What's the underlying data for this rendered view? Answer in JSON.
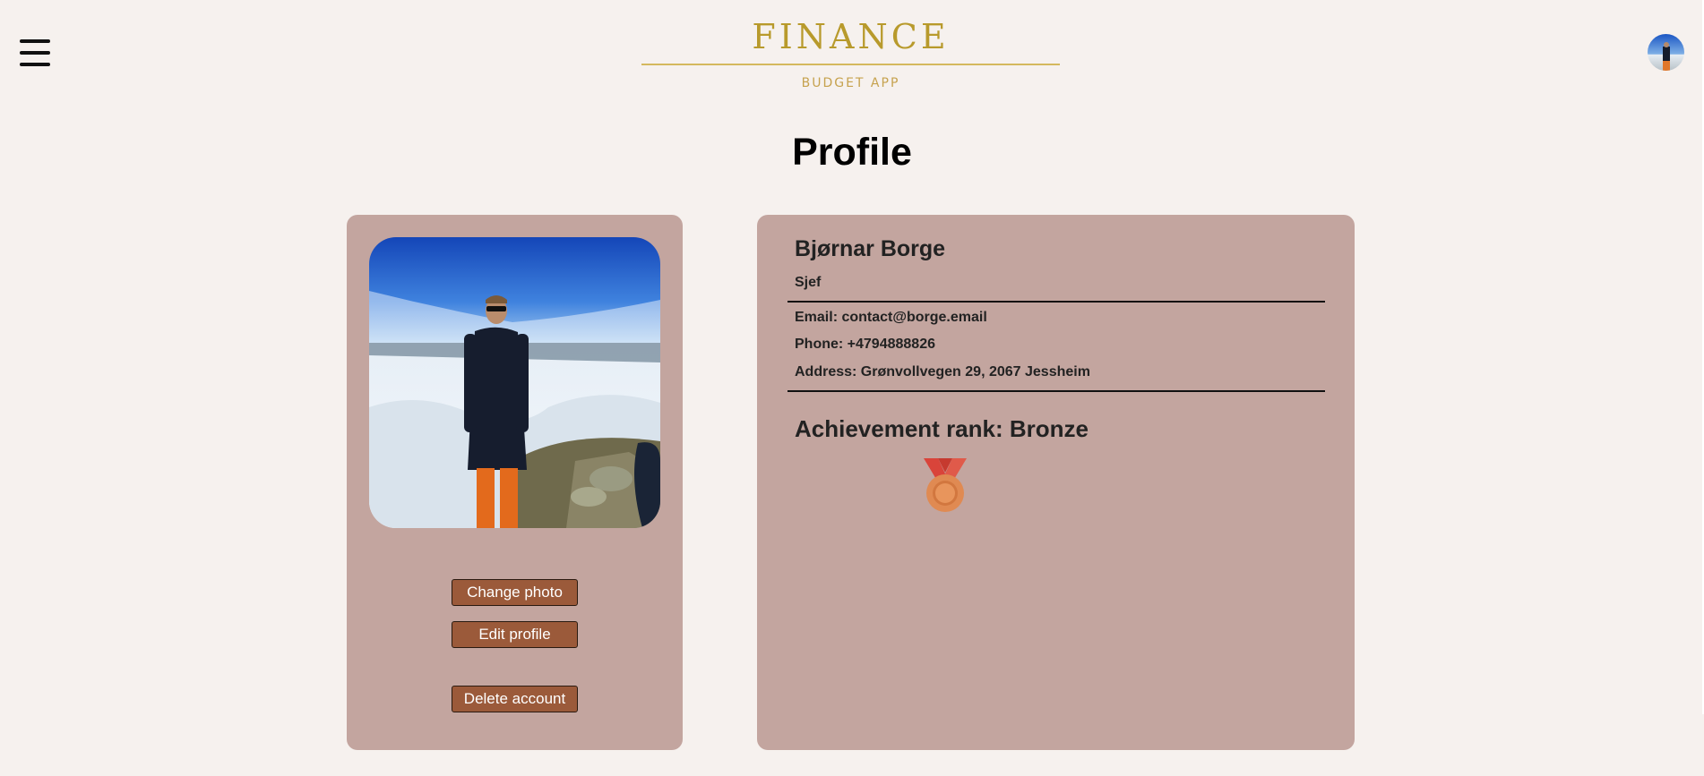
{
  "header": {
    "logo_title": "FINANCE",
    "logo_subtitle": "BUDGET APP",
    "menu_icon": "hamburger-menu-icon",
    "avatar_icon": "user-avatar"
  },
  "page": {
    "title": "Profile"
  },
  "photo_card": {
    "change_photo_label": "Change photo",
    "edit_profile_label": "Edit profile",
    "delete_account_label": "Delete account"
  },
  "profile": {
    "name": "Bjørnar Borge",
    "role": "Sjef",
    "email_line": "Email: contact@borge.email",
    "phone_line": "Phone: +4794888826",
    "address_line": "Address: Grønvollvegen 29, 2067 Jessheim",
    "achievement_line": "Achievement rank: Bronze",
    "medal_icon": "bronze-medal-icon"
  },
  "colors": {
    "background": "#f6f1ee",
    "card": "#c3a59f",
    "button": "#9b5a3a",
    "logo_gold": "#b89a2c"
  }
}
